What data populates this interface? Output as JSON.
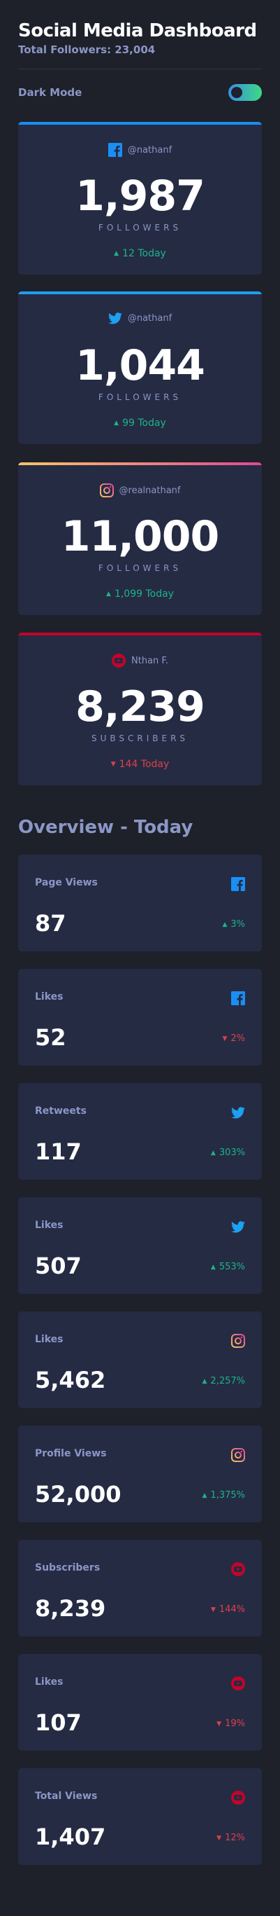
{
  "header": {
    "title": "Social Media Dashboard",
    "total_followers": "Total Followers: 23,004"
  },
  "mode": {
    "label": "Dark Mode",
    "enabled": true
  },
  "colors": {
    "facebook": "#198ff5",
    "twitter": "#1ca0f2",
    "instagram_gradient": [
      "#fdc468",
      "#df4996"
    ],
    "youtube": "#c4032b",
    "positive": "#1db489",
    "negative": "#dc414c"
  },
  "cards": [
    {
      "platform": "facebook",
      "icon": "facebook-icon",
      "handle": "@nathanf",
      "count": "1,987",
      "unit": "FOLLOWERS",
      "arrow": "▲",
      "change": "12 Today",
      "trend": "up"
    },
    {
      "platform": "twitter",
      "icon": "twitter-icon",
      "handle": "@nathanf",
      "count": "1,044",
      "unit": "FOLLOWERS",
      "arrow": "▲",
      "change": "99 Today",
      "trend": "up"
    },
    {
      "platform": "instagram",
      "icon": "instagram-icon",
      "handle": "@realnathanf",
      "count": "11,000",
      "unit": "FOLLOWERS",
      "arrow": "▲",
      "change": "1,099 Today",
      "trend": "up"
    },
    {
      "platform": "youtube",
      "icon": "youtube-icon",
      "handle": "Nthan F.",
      "count": "8,239",
      "unit": "SUBSCRIBERS",
      "arrow": "▼",
      "change": "144 Today",
      "trend": "down"
    }
  ],
  "overview": {
    "title": "Overview - Today",
    "items": [
      {
        "label": "Page Views",
        "platform": "facebook",
        "icon": "facebook-icon",
        "value": "87",
        "arrow": "▲",
        "change": "3%",
        "trend": "up"
      },
      {
        "label": "Likes",
        "platform": "facebook",
        "icon": "facebook-icon",
        "value": "52",
        "arrow": "▼",
        "change": "2%",
        "trend": "down"
      },
      {
        "label": "Retweets",
        "platform": "twitter",
        "icon": "twitter-icon",
        "value": "117",
        "arrow": "▲",
        "change": "303%",
        "trend": "up"
      },
      {
        "label": "Likes",
        "platform": "twitter",
        "icon": "twitter-icon",
        "value": "507",
        "arrow": "▲",
        "change": "553%",
        "trend": "up"
      },
      {
        "label": "Likes",
        "platform": "instagram",
        "icon": "instagram-icon",
        "value": "5,462",
        "arrow": "▲",
        "change": "2,257%",
        "trend": "up"
      },
      {
        "label": "Profile Views",
        "platform": "instagram",
        "icon": "instagram-icon",
        "value": "52,000",
        "arrow": "▲",
        "change": "1,375%",
        "trend": "up"
      },
      {
        "label": "Subscribers",
        "platform": "youtube",
        "icon": "youtube-icon",
        "value": "8,239",
        "arrow": "▼",
        "change": "144%",
        "trend": "down"
      },
      {
        "label": "Likes",
        "platform": "youtube",
        "icon": "youtube-icon",
        "value": "107",
        "arrow": "▼",
        "change": "19%",
        "trend": "down"
      },
      {
        "label": "Total Views",
        "platform": "youtube",
        "icon": "youtube-icon",
        "value": "1,407",
        "arrow": "▼",
        "change": "12%",
        "trend": "down"
      }
    ]
  }
}
